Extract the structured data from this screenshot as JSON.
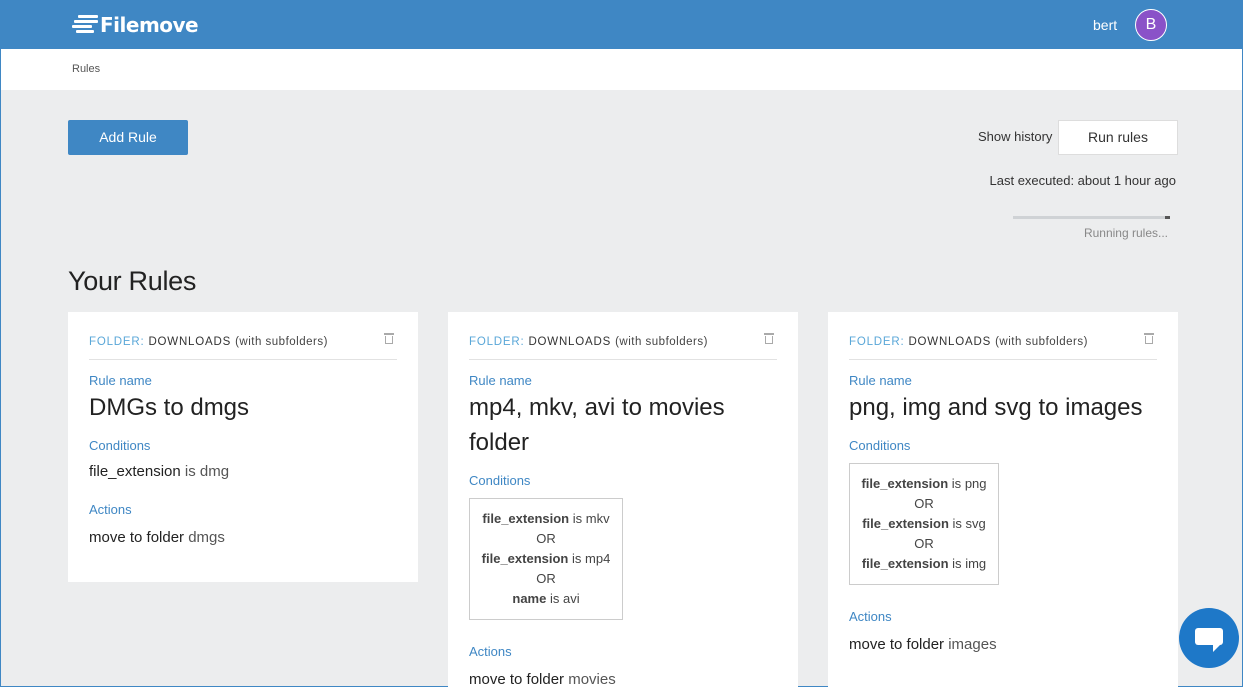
{
  "header": {
    "logo_text": "Filemove",
    "user_name": "bert",
    "avatar_initial": "B",
    "colors": {
      "bar": "#3f87c4",
      "avatar": "#8a52c8"
    }
  },
  "breadcrumb": "Rules",
  "toolbar": {
    "add_rule_label": "Add Rule",
    "show_history_label": "Show history",
    "run_rules_label": "Run rules",
    "last_executed": "Last executed: about 1 hour ago",
    "running_status": "Running rules...",
    "progress": 0.03
  },
  "section_title": "Your Rules",
  "labels": {
    "folder": "FOLDER:",
    "rule_name": "Rule name",
    "conditions": "Conditions",
    "actions": "Actions",
    "or": "OR",
    "is": "is",
    "move_to_folder": "move to folder"
  },
  "rules": [
    {
      "folder": "DOWNLOADS",
      "subfolders": "(with subfolders)",
      "name": "DMGs to dmgs",
      "conditions": [
        {
          "field": "file_extension",
          "value": "dmg"
        }
      ],
      "action_target": "dmgs"
    },
    {
      "folder": "DOWNLOADS",
      "subfolders": "(with subfolders)",
      "name": "mp4, mkv, avi to movies folder",
      "conditions": [
        {
          "field": "file_extension",
          "value": "mkv"
        },
        {
          "field": "file_extension",
          "value": "mp4"
        },
        {
          "field": "name",
          "value": "avi"
        }
      ],
      "action_target": "movies"
    },
    {
      "folder": "DOWNLOADS",
      "subfolders": "(with subfolders)",
      "name": "png, img and svg to images",
      "conditions": [
        {
          "field": "file_extension",
          "value": "png"
        },
        {
          "field": "file_extension",
          "value": "svg"
        },
        {
          "field": "file_extension",
          "value": "img"
        }
      ],
      "action_target": "images"
    }
  ],
  "chat_icon": "chat-bubble-icon"
}
